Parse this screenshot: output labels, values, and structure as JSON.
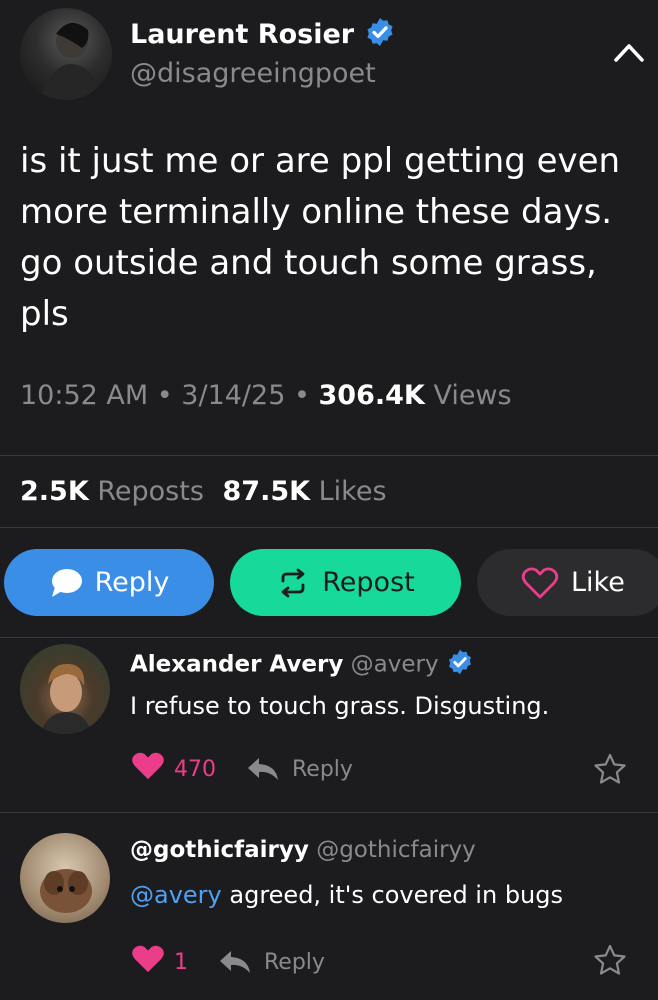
{
  "post": {
    "author_name": "Laurent Rosier",
    "author_handle": "@disagreeingpoet",
    "text": "is it just me or are ppl getting even more terminally online these days. go outside and touch some grass, pls",
    "time": "10:52 AM",
    "sep1": "•",
    "date": "3/14/25",
    "sep2": "•",
    "views_count": "306.4K",
    "views_label": "Views",
    "reposts_count": "2.5K",
    "reposts_label": "Reposts",
    "likes_count": "87.5K",
    "likes_label": "Likes"
  },
  "actions": {
    "reply_label": "Reply",
    "repost_label": "Repost",
    "like_label": "Like",
    "reply_color": "#3b8ee6",
    "repost_color": "#17d99a",
    "like_color": "#2c2c2e"
  },
  "replies": [
    {
      "name": "Alexander Avery",
      "handle": "@avery",
      "verified": true,
      "mention": "",
      "text": "I refuse to touch grass. Disgusting.",
      "likes": "470",
      "reply_label": "Reply"
    },
    {
      "name": "@gothicfairyy",
      "handle": "@gothicfairyy",
      "verified": false,
      "mention": "@avery",
      "text": " agreed, it's covered in bugs",
      "likes": "1",
      "reply_label": "Reply"
    }
  ],
  "colors": {
    "background": "#1c1c1e",
    "verified": "#3b8ee6",
    "heart": "#ec3d8a",
    "mention": "#4ea1f3"
  }
}
